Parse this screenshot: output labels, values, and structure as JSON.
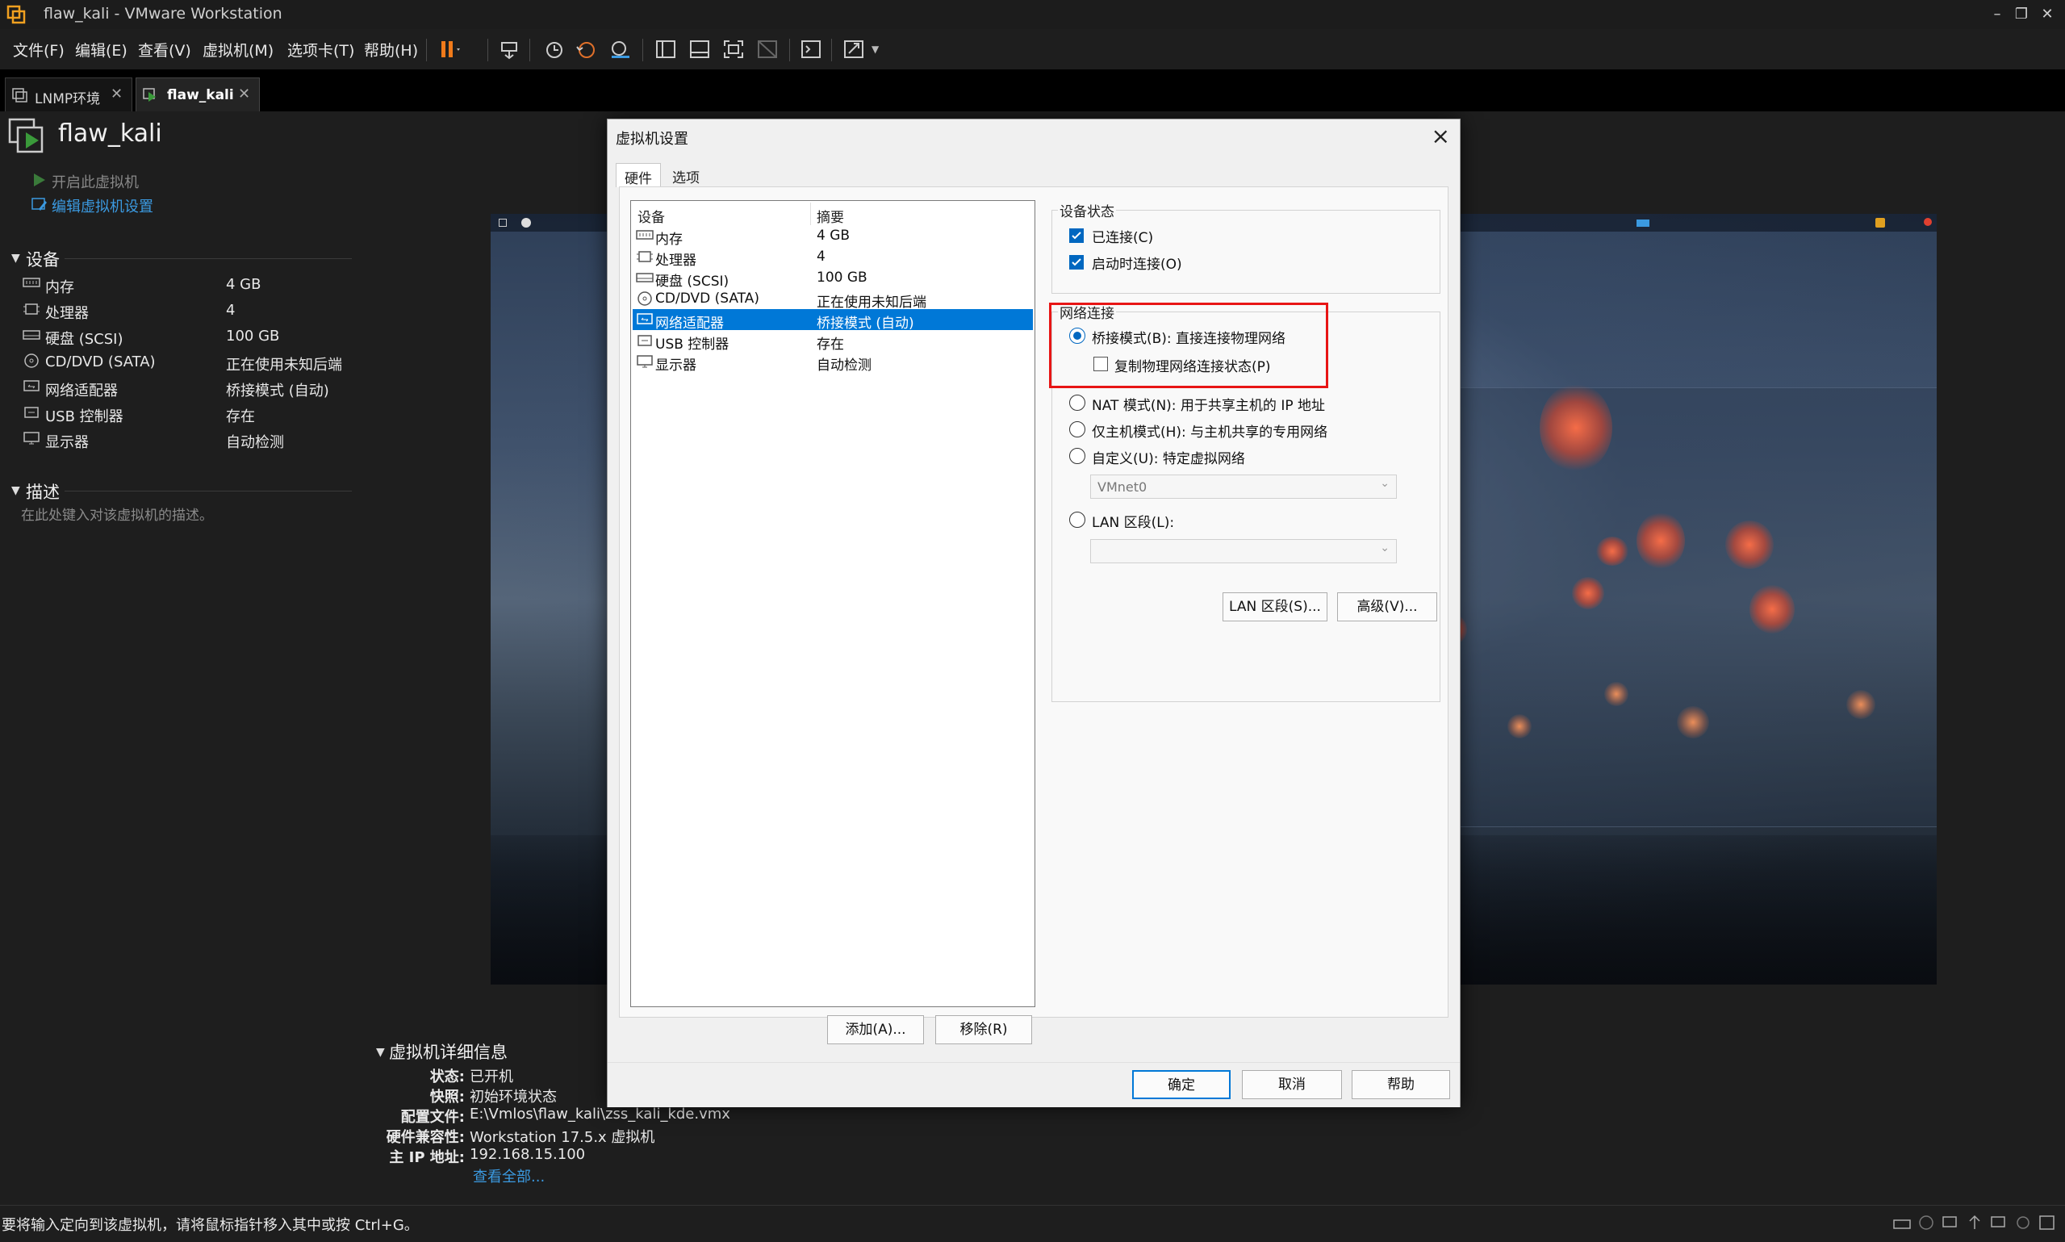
{
  "window": {
    "title": "flaw_kali - VMware Workstation"
  },
  "menu": [
    "文件(F)",
    "编辑(E)",
    "查看(V)",
    "虚拟机(M)",
    "选项卡(T)",
    "帮助(H)"
  ],
  "tabs": [
    {
      "label": "LNMP环境",
      "active": false
    },
    {
      "label": "flaw_kali",
      "active": true
    }
  ],
  "vm": {
    "name": "flaw_kali",
    "actions": {
      "power_on": "开启此虚拟机",
      "edit_settings": "编辑虚拟机设置"
    }
  },
  "devices_section": {
    "title": "设备",
    "items": [
      {
        "icon": "memory-icon",
        "name": "内存",
        "value": "4 GB"
      },
      {
        "icon": "cpu-icon",
        "name": "处理器",
        "value": "4"
      },
      {
        "icon": "hdd-icon",
        "name": "硬盘 (SCSI)",
        "value": "100 GB"
      },
      {
        "icon": "cd-icon",
        "name": "CD/DVD (SATA)",
        "value": "正在使用未知后端"
      },
      {
        "icon": "network-icon",
        "name": "网络适配器",
        "value": "桥接模式 (自动)"
      },
      {
        "icon": "usb-icon",
        "name": "USB 控制器",
        "value": "存在"
      },
      {
        "icon": "monitor-icon",
        "name": "显示器",
        "value": "自动检测"
      }
    ]
  },
  "description_section": {
    "title": "描述",
    "placeholder": "在此处键入对该虚拟机的描述。"
  },
  "details": {
    "title": "虚拟机详细信息",
    "rows": [
      {
        "key": "状态:",
        "value": "已开机"
      },
      {
        "key": "快照:",
        "value": "初始环境状态"
      },
      {
        "key": "配置文件:",
        "value": "E:\\Vmlos\\flaw_kali\\zss_kali_kde.vmx"
      },
      {
        "key": "硬件兼容性:",
        "value": "Workstation 17.5.x 虚拟机"
      },
      {
        "key": "主 IP 地址:",
        "value": "192.168.15.100"
      }
    ],
    "view_all": "查看全部..."
  },
  "statusbar": {
    "message": "要将输入定向到该虚拟机，请将鼠标指针移入其中或按 Ctrl+G。"
  },
  "dialog": {
    "title": "虚拟机设置",
    "tabs": [
      "硬件",
      "选项"
    ],
    "list_headers": {
      "device": "设备",
      "summary": "摘要"
    },
    "devices": [
      {
        "icon": "memory-icon",
        "name": "内存",
        "summary": "4 GB"
      },
      {
        "icon": "cpu-icon",
        "name": "处理器",
        "summary": "4"
      },
      {
        "icon": "hdd-icon",
        "name": "硬盘 (SCSI)",
        "summary": "100 GB"
      },
      {
        "icon": "cd-icon",
        "name": "CD/DVD (SATA)",
        "summary": "正在使用未知后端"
      },
      {
        "icon": "network-icon",
        "name": "网络适配器",
        "summary": "桥接模式 (自动)",
        "selected": true
      },
      {
        "icon": "usb-icon",
        "name": "USB 控制器",
        "summary": "存在"
      },
      {
        "icon": "monitor-icon",
        "name": "显示器",
        "summary": "自动检测"
      }
    ],
    "device_status": {
      "title": "设备状态",
      "connected": "已连接(C)",
      "connect_at_power_on": "启动时连接(O)"
    },
    "network": {
      "title": "网络连接",
      "bridged": "桥接模式(B): 直接连接物理网络",
      "replicate": "复制物理网络连接状态(P)",
      "nat": "NAT 模式(N): 用于共享主机的 IP 地址",
      "host_only": "仅主机模式(H): 与主机共享的专用网络",
      "custom": "自定义(U): 特定虚拟网络",
      "custom_value": "VMnet0",
      "lan": "LAN 区段(L):",
      "lan_value": ""
    },
    "buttons": {
      "lan_segments": "LAN 区段(S)...",
      "advanced": "高级(V)...",
      "add": "添加(A)...",
      "remove": "移除(R)",
      "ok": "确定",
      "cancel": "取消",
      "help": "帮助"
    }
  },
  "colors": {
    "accent": "#0078d7",
    "highlight_box": "#e81515",
    "link": "#3b9ae1",
    "play": "#3a9a3a"
  }
}
